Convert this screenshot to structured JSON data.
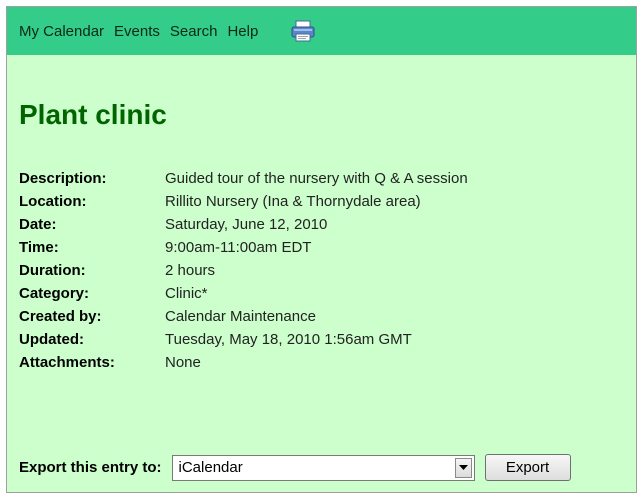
{
  "nav": {
    "items": [
      {
        "label": "My Calendar"
      },
      {
        "label": "Events"
      },
      {
        "label": "Search"
      },
      {
        "label": "Help"
      }
    ],
    "print_icon": "printer-icon"
  },
  "event": {
    "title": "Plant clinic",
    "details": [
      {
        "label": "Description:",
        "value": "Guided tour of the nursery with Q & A session"
      },
      {
        "label": "Location:",
        "value": "Rillito Nursery (Ina & Thornydale area)"
      },
      {
        "label": "Date:",
        "value": "Saturday, June 12, 2010"
      },
      {
        "label": "Time:",
        "value": "9:00am-11:00am EDT"
      },
      {
        "label": "Duration:",
        "value": "2 hours"
      },
      {
        "label": "Category:",
        "value": "Clinic*"
      },
      {
        "label": "Created by:",
        "value": "Calendar Maintenance"
      },
      {
        "label": "Updated:",
        "value": "Tuesday, May 18, 2010 1:56am GMT"
      },
      {
        "label": "Attachments:",
        "value": "None"
      }
    ]
  },
  "export": {
    "label": "Export this entry to:",
    "selected": "iCalendar",
    "button": "Export"
  },
  "colors": {
    "page_background": "#ccffcc",
    "navbar": "#33cc88",
    "title": "#006400"
  }
}
